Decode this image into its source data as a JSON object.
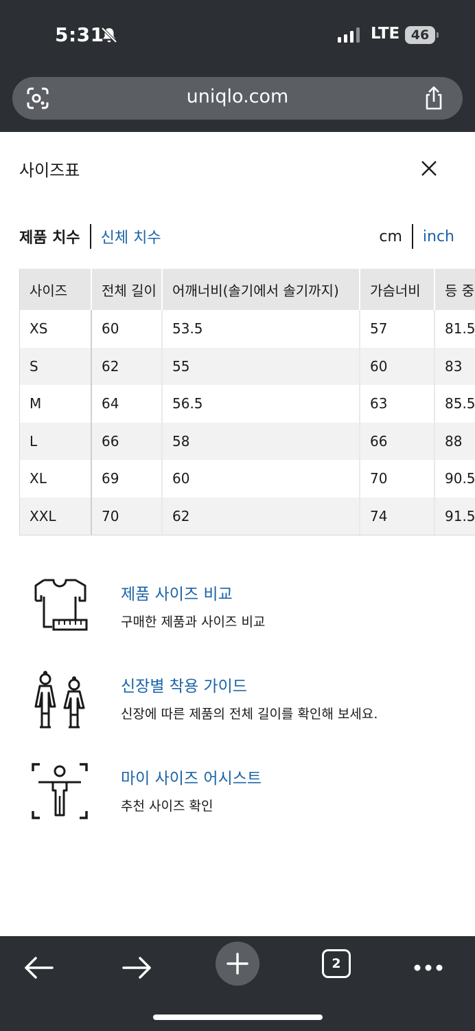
{
  "status": {
    "time": "5:31",
    "network": "LTE",
    "battery": "46"
  },
  "browser": {
    "url": "uniqlo.com",
    "tab_count": "2"
  },
  "modal": {
    "title": "사이즈표"
  },
  "tabs": {
    "product": "제품 치수",
    "body": "신체 치수"
  },
  "units": {
    "cm": "cm",
    "inch": "inch"
  },
  "table": {
    "headers": [
      "사이즈",
      "전체 길이",
      "어깨너비(솔기에서 솔기까지)",
      "가슴너비",
      "등 중"
    ],
    "rows": [
      [
        "XS",
        "60",
        "53.5",
        "57",
        "81.5"
      ],
      [
        "S",
        "62",
        "55",
        "60",
        "83"
      ],
      [
        "M",
        "64",
        "56.5",
        "63",
        "85.5"
      ],
      [
        "L",
        "66",
        "58",
        "66",
        "88"
      ],
      [
        "XL",
        "69",
        "60",
        "70",
        "90.5"
      ],
      [
        "XXL",
        "70",
        "62",
        "74",
        "91.5"
      ]
    ]
  },
  "features": [
    {
      "title": "제품 사이즈 비교",
      "desc": "구매한 제품과 사이즈 비교",
      "icon": "shirt-measure-icon"
    },
    {
      "title": "신장별 착용 가이드",
      "desc": "신장에 따른 제품의 전체 길이를 확인해 보세요.",
      "icon": "height-guide-icon"
    },
    {
      "title": "마이 사이즈 어시스트",
      "desc": "추천 사이즈 확인",
      "icon": "body-scan-icon"
    }
  ],
  "colors": {
    "link": "#1b63a8",
    "chrome": "#2c2f33"
  }
}
